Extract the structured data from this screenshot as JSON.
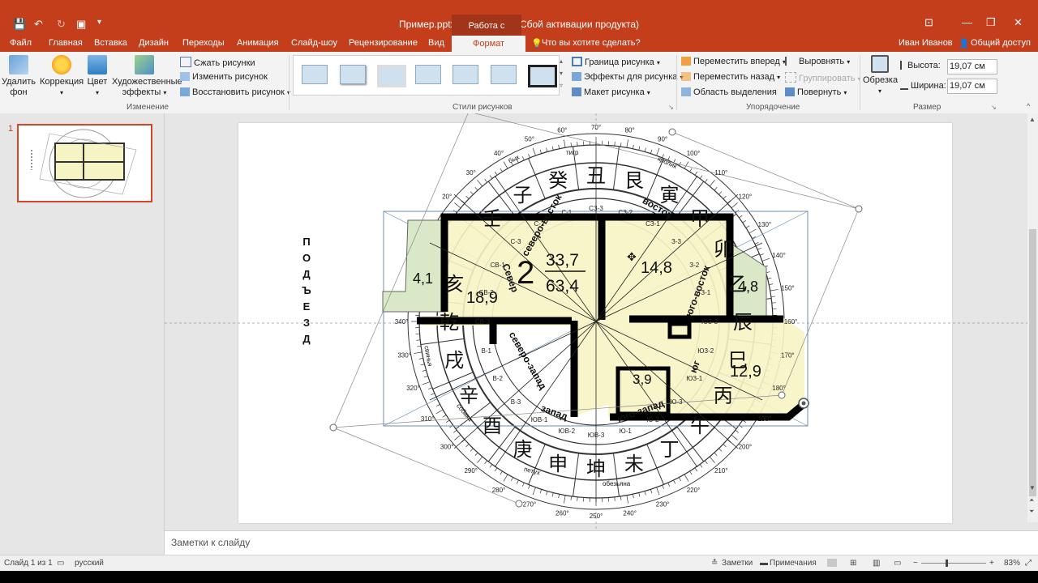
{
  "window": {
    "title": "Пример.pptx - PowerPoint (Сбой активации продукта)",
    "context_tab_header": "Работа с рисунками",
    "user": "Иван Иванов",
    "share_label": "Общий доступ"
  },
  "menu": {
    "items": [
      "Файл",
      "Главная",
      "Вставка",
      "Дизайн",
      "Переходы",
      "Анимация",
      "Слайд-шоу",
      "Рецензирование",
      "Вид"
    ],
    "active": "Формат",
    "tell_me": "Что вы хотите сделать?"
  },
  "ribbon": {
    "remove_bg": "Удалить фон",
    "correction": "Коррекция",
    "color": "Цвет",
    "art_effects": "Художественные эффекты",
    "compress": "Сжать рисунки",
    "change": "Изменить рисунок",
    "reset": "Восстановить рисунок",
    "group_adjust": "Изменение",
    "group_styles": "Стили рисунков",
    "border": "Граница рисунка",
    "effects": "Эффекты для рисунка",
    "layout": "Макет рисунка",
    "bring_forward": "Переместить вперед",
    "send_backward": "Переместить назад",
    "selection_pane": "Область выделения",
    "align": "Выровнять",
    "group": "Группировать",
    "rotate": "Повернуть",
    "group_arrange": "Упорядочение",
    "crop": "Обрезка",
    "height_label": "Высота:",
    "height_value": "19,07 см",
    "width_label": "Ширина:",
    "width_value": "19,07 см",
    "group_size": "Размер"
  },
  "thumbnails": {
    "slide_number": "1"
  },
  "slide": {
    "entrance_letters": [
      "П",
      "О",
      "Д",
      "Ъ",
      "Е",
      "З",
      "Д"
    ],
    "room_2_number": "2",
    "room_2_area_top": "33,7",
    "room_2_area_bottom": "63,4",
    "area_18_9": "18,9",
    "area_14_8": "14,8",
    "area_4_1": "4,1",
    "area_4_8": "4,8",
    "area_12_9": "12,9",
    "area_3_9": "3,9",
    "dir_north": "Север",
    "dir_northeast": "северо-восток",
    "dir_east": "восток",
    "dir_southeast": "юго-восток",
    "dir_south": "юг",
    "dir_southwest": "юго-запад",
    "dir_west": "запад",
    "dir_northwest": "северо-запад",
    "animal_pig": "свинья",
    "animal_dog": "собака",
    "animal_rooster": "петух",
    "animal_monkey": "обезьяна",
    "animal_bull": "бык",
    "animal_tiger": "тигр",
    "animal_rabbit": "кролик",
    "hanzi_ring": [
      "亥",
      "乾",
      "戌",
      "辛",
      "酉",
      "庚",
      "申",
      "坤",
      "未",
      "丁",
      "午",
      "丙",
      "巳",
      "辰",
      "乙",
      "卯",
      "甲",
      "寅",
      "艮",
      "丑",
      "癸",
      "子",
      "壬"
    ],
    "degree_labels": [
      "60°",
      "70°",
      "80°",
      "90°",
      "100°",
      "110°",
      "120°",
      "130°",
      "140°",
      "150°",
      "160°",
      "170°",
      "180°",
      "190°",
      "200°",
      "210°",
      "220°",
      "230°",
      "240°",
      "250°",
      "260°",
      "270°",
      "280°",
      "290°",
      "300°",
      "310°",
      "320°",
      "330°",
      "340°",
      "20°",
      "30°",
      "40°",
      "50°"
    ],
    "sector_codes": [
      "С-1",
      "С-2",
      "С-3",
      "СВ-1",
      "СВ-2",
      "СВ-3",
      "В-1",
      "В-2",
      "В-3",
      "ЮВ-1",
      "ЮВ-2",
      "ЮВ-3",
      "Ю-1",
      "Ю-2",
      "Ю-3",
      "ЮЗ-1",
      "ЮЗ-2",
      "ЮЗ-3",
      "З-1",
      "З-2",
      "З-3",
      "СЗ-1",
      "СЗ-2",
      "СЗ-3"
    ]
  },
  "notes": {
    "placeholder": "Заметки к слайду"
  },
  "status": {
    "slide_of": "Слайд 1 из 1",
    "language": "русский",
    "notes_btn": "Заметки",
    "comments_btn": "Примечания",
    "zoom": "83%"
  },
  "colors": {
    "accent": "#c43e1c",
    "plan_fill": "#f7f4c4",
    "wall": "#000000",
    "ribbon_bg": "#f3f3f3"
  }
}
